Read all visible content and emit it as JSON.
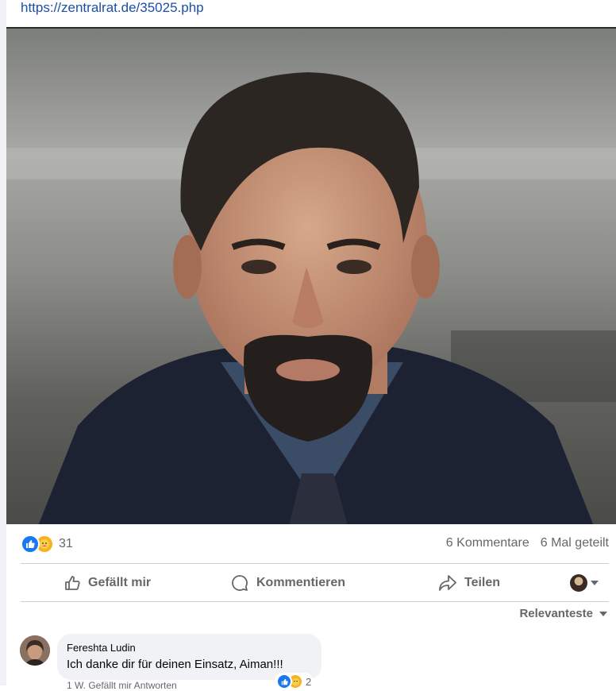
{
  "post": {
    "link_text": "https://zentralrat.de/35025.php"
  },
  "stats": {
    "reaction_count": "31",
    "comments": "6 Kommentare",
    "shares": "6 Mal geteilt"
  },
  "actions": {
    "like": "Gefällt mir",
    "comment": "Kommentieren",
    "share": "Teilen"
  },
  "sort": {
    "label": "Relevanteste"
  },
  "comment": {
    "author": "Fereshta Ludin",
    "text": "Ich danke dir für deinen Einsatz, Aiman!!!",
    "reaction_count": "2",
    "meta": "1 W.  Gefällt mir  Antworten"
  },
  "colors": {
    "like_blue": "#1877f2",
    "care_yellow": "#f7b125",
    "link": "#1b4fa8"
  }
}
